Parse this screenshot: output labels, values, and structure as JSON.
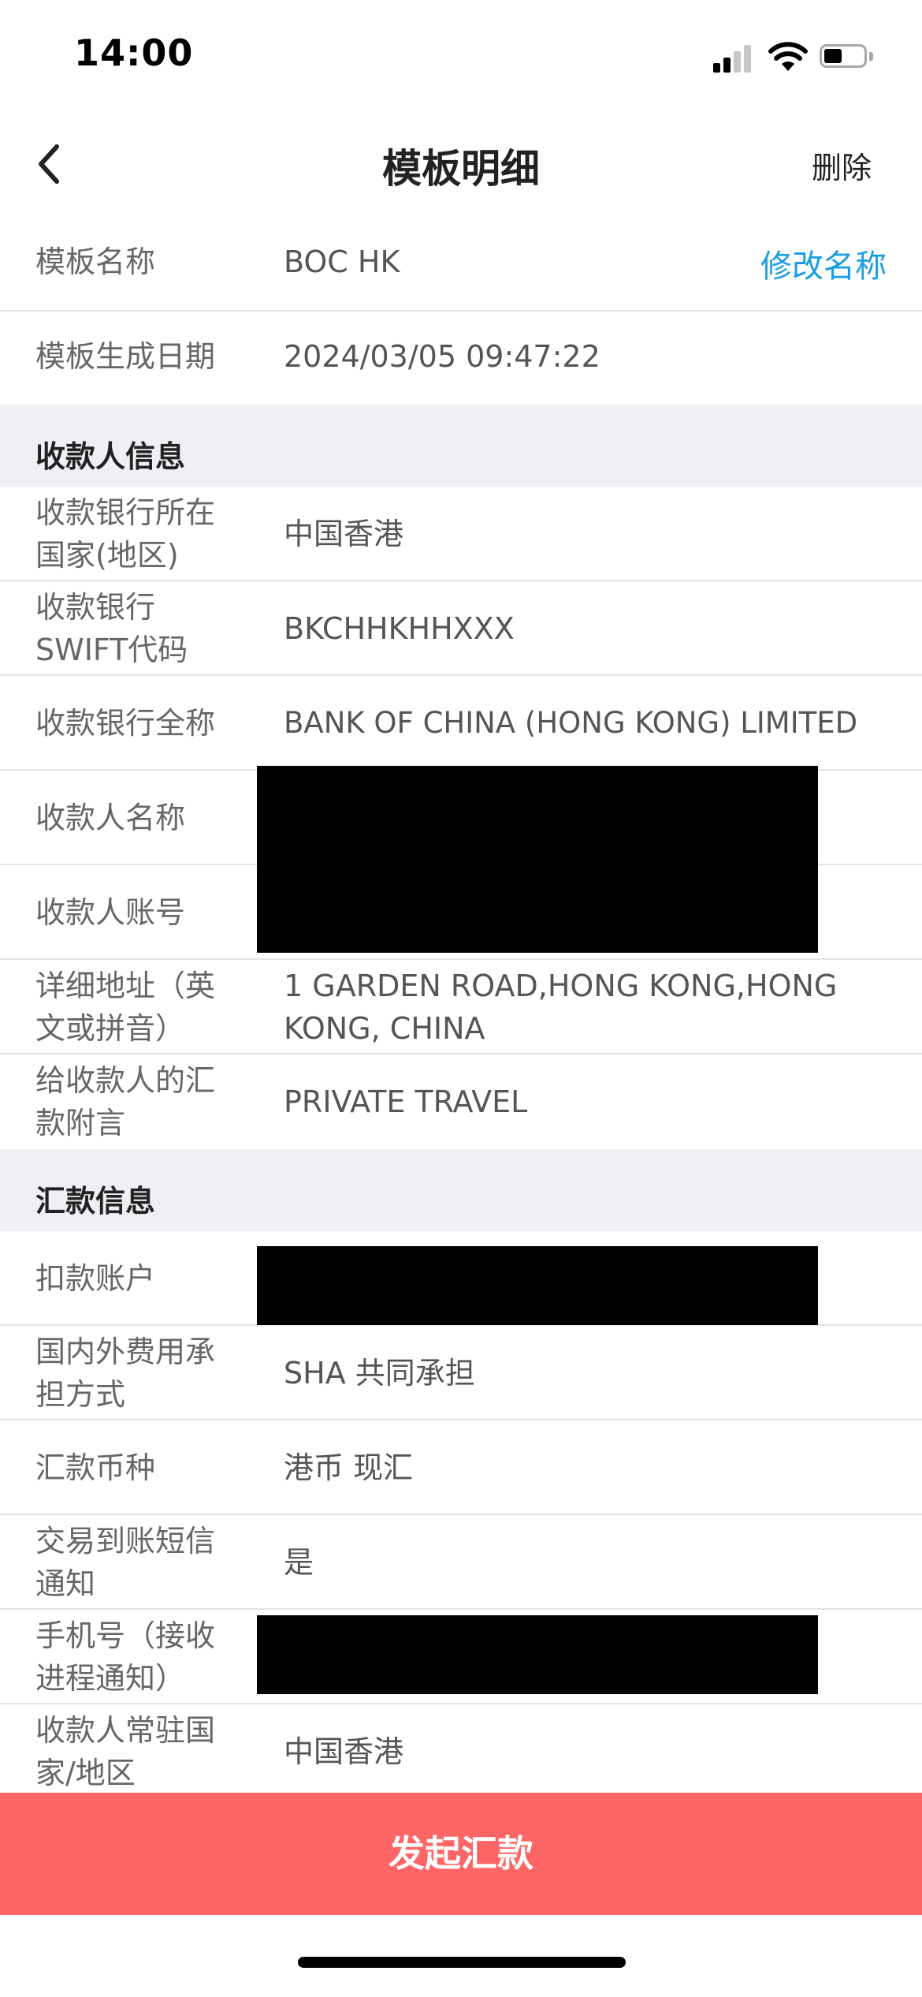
{
  "status_bar": {
    "time": "14:00"
  },
  "nav": {
    "title": "模板明细",
    "delete_label": "删除"
  },
  "template": {
    "name_label": "模板名称",
    "name_value": "BOC HK",
    "rename_label": "修改名称",
    "date_label": "模板生成日期",
    "date_value": "2024/03/05 09:47:22"
  },
  "payee_section": {
    "title": "收款人信息",
    "rows": [
      {
        "label": "收款银行所在国家(地区)",
        "value": "中国香港"
      },
      {
        "label": "收款银行SWIFT代码",
        "value": "BKCHHKHHXXX"
      },
      {
        "label": "收款银行全称",
        "value": "BANK OF CHINA (HONG KONG) LIMITED"
      },
      {
        "label": "收款人名称",
        "value": ""
      },
      {
        "label": "收款人账号",
        "value": ""
      },
      {
        "label": "详细地址（英文或拼音）",
        "value": "1 GARDEN ROAD,HONG KONG,HONG KONG, CHINA"
      },
      {
        "label": "给收款人的汇款附言",
        "value": "PRIVATE TRAVEL"
      }
    ]
  },
  "remit_section": {
    "title": "汇款信息",
    "rows": [
      {
        "label": "扣款账户",
        "value": ""
      },
      {
        "label": "国内外费用承担方式",
        "value": "SHA 共同承担"
      },
      {
        "label": "汇款币种",
        "value": "港币 现汇"
      },
      {
        "label": "交易到账短信通知",
        "value": "是"
      },
      {
        "label": "手机号（接收进程通知）",
        "value": ""
      },
      {
        "label": "收款人常驻国家/地区",
        "value": "中国香港"
      }
    ]
  },
  "submit_label": "发起汇款",
  "colors": {
    "accent": "#1a9ee3",
    "button": "#fd6566",
    "section_bg": "#efeff4"
  }
}
